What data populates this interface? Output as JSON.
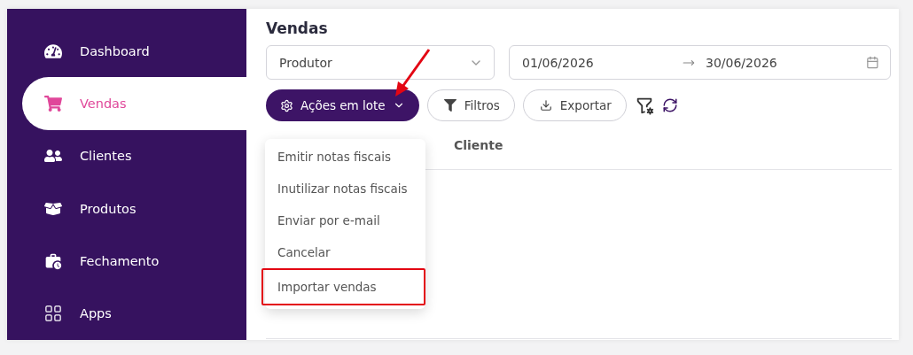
{
  "sidebar": {
    "items": [
      {
        "label": "Dashboard",
        "selected": false
      },
      {
        "label": "Vendas",
        "selected": true
      },
      {
        "label": "Clientes",
        "selected": false
      },
      {
        "label": "Produtos",
        "selected": false
      },
      {
        "label": "Fechamento",
        "selected": false
      },
      {
        "label": "Apps",
        "selected": false
      }
    ]
  },
  "page": {
    "title": "Vendas"
  },
  "filters": {
    "select": {
      "value": "Produtor"
    },
    "date_range": {
      "start": "01/06/2026",
      "end": "30/06/2026"
    }
  },
  "toolbar": {
    "bulk_actions": {
      "label": "Ações em lote",
      "expanded": true
    },
    "buttons": [
      "Filtros",
      "Exportar"
    ]
  },
  "bulk_menu": [
    {
      "label": "Emitir notas fiscais",
      "highlighted": false
    },
    {
      "label": "Inutilizar notas fiscais",
      "highlighted": false
    },
    {
      "label": "Enviar por e-mail",
      "highlighted": false
    },
    {
      "label": "Cancelar",
      "highlighted": false
    },
    {
      "label": "Importar vendas",
      "highlighted": true
    }
  ],
  "table": {
    "columns": [
      "Cliente"
    ]
  }
}
